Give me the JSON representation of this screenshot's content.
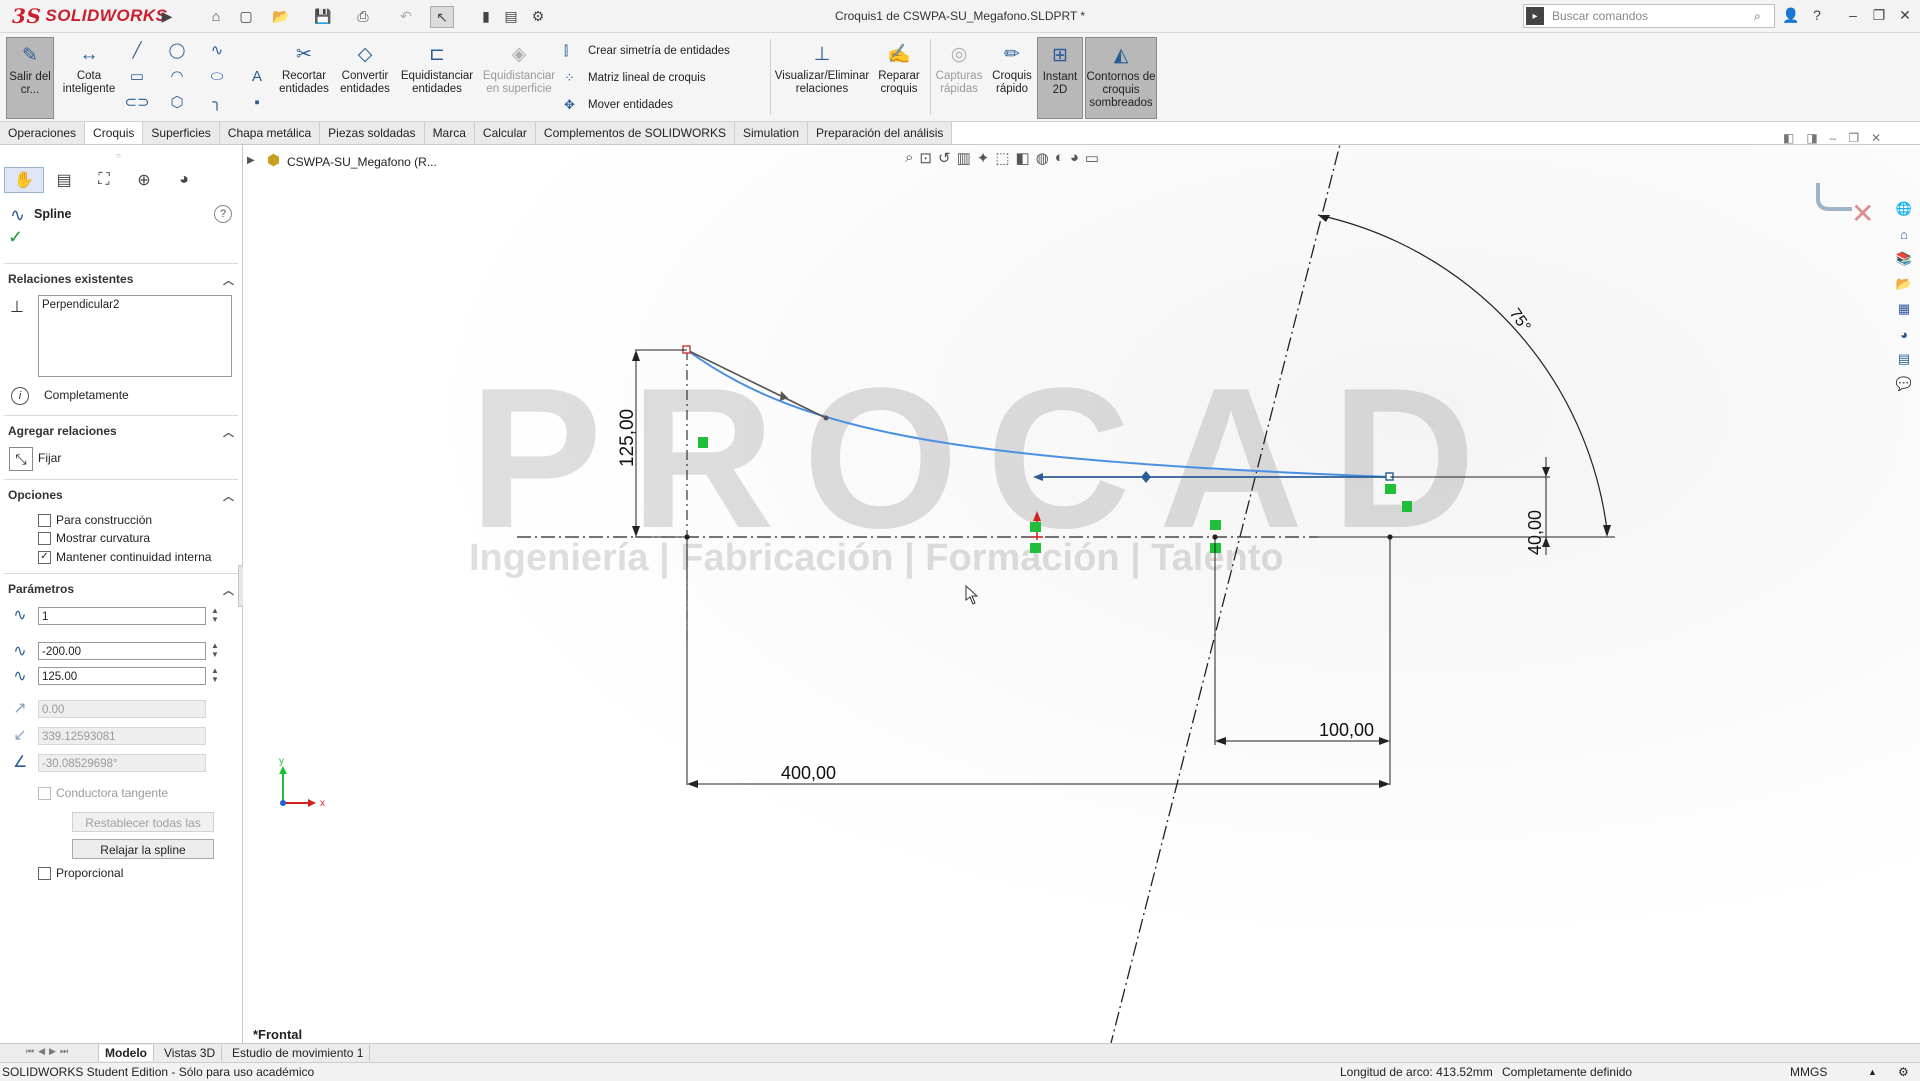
{
  "app": {
    "logo_text": "SOLIDWORKS",
    "logo_mark": "3S",
    "document_title": "Croquis1 de CSWPA-SU_Megafono.SLDPRT *"
  },
  "search": {
    "placeholder": "Buscar comandos"
  },
  "toolbar": {
    "exit_sketch": "Salir del cr...",
    "smart_dimension": "Cota inteligente",
    "trim": "Recortar entidades",
    "convert": "Convertir entidades",
    "offset": "Equidistanciar entidades",
    "offset_surface": "Equidistanciar en superficie",
    "mirror": "Crear simetría de entidades",
    "linear_pattern": "Matriz lineal de croquis",
    "move": "Mover entidades",
    "display_relations": "Visualizar/Eliminar relaciones",
    "repair_sketch": "Reparar croquis",
    "quick_snaps": "Capturas rápidas",
    "rapid_sketch": "Croquis rápido",
    "instant2d": "Instant 2D",
    "shaded_contours": "Contornos de croquis sombreados"
  },
  "tabs": [
    "Operaciones",
    "Croquis",
    "Superficies",
    "Chapa metálica",
    "Piezas soldadas",
    "Marca",
    "Calcular",
    "Complementos de SOLIDWORKS",
    "Simulation",
    "Preparación del análisis"
  ],
  "active_tab": "Croquis",
  "tree": {
    "part_name": "CSWPA-SU_Megafono (R..."
  },
  "panel": {
    "title": "Spline",
    "existing_relations": {
      "header": "Relaciones existentes",
      "items": [
        "Perpendicular2"
      ],
      "status": "Completamente"
    },
    "add_relations": {
      "header": "Agregar relaciones",
      "item": "Fijar"
    },
    "options": {
      "header": "Opciones",
      "construction": {
        "label": "Para construcción",
        "checked": false
      },
      "show_curvature": {
        "label": "Mostrar curvatura",
        "checked": false
      },
      "keep_continuity": {
        "label": "Mantener continuidad interna",
        "checked": true
      }
    },
    "parameters": {
      "header": "Parámetros",
      "point_number": "1",
      "x": "-200.00",
      "y": "125.00",
      "tangent_weight1": "0.00",
      "tangent_weight2": "339.12593081",
      "tangent_angle": "-30.08529698°",
      "tangent_driving": {
        "label": "Conductora tangente",
        "checked": false
      },
      "reset_handles": "Restablecer todas las asas",
      "relax": "Relajar la spline",
      "proportional": {
        "label": "Proporcional",
        "checked": false
      }
    }
  },
  "sketch": {
    "dimensions": {
      "height": "125,00",
      "width": "400,00",
      "offset": "100,00",
      "small_height": "40,00",
      "angle": "75°"
    },
    "watermark": {
      "brand": "PROCAD",
      "tagline": "Ingeniería | Fabricación | Formación | Talento"
    }
  },
  "view_label": "*Frontal",
  "axis_labels": {
    "x": "x",
    "y": "y"
  },
  "bottom_tabs": [
    "Modelo",
    "Vistas 3D",
    "Estudio de movimiento 1"
  ],
  "status": {
    "edition": "SOLIDWORKS Student Edition - Sólo para uso académico",
    "arc_length": "Longitud de arco: 413.52mm",
    "definition": "Completamente definido",
    "units": "MMGS"
  },
  "colors": {
    "accent": "#2a5d96",
    "spline": "#4a90e2",
    "relation_green": "#1fbf3a",
    "brand_red": "#c8202f"
  }
}
